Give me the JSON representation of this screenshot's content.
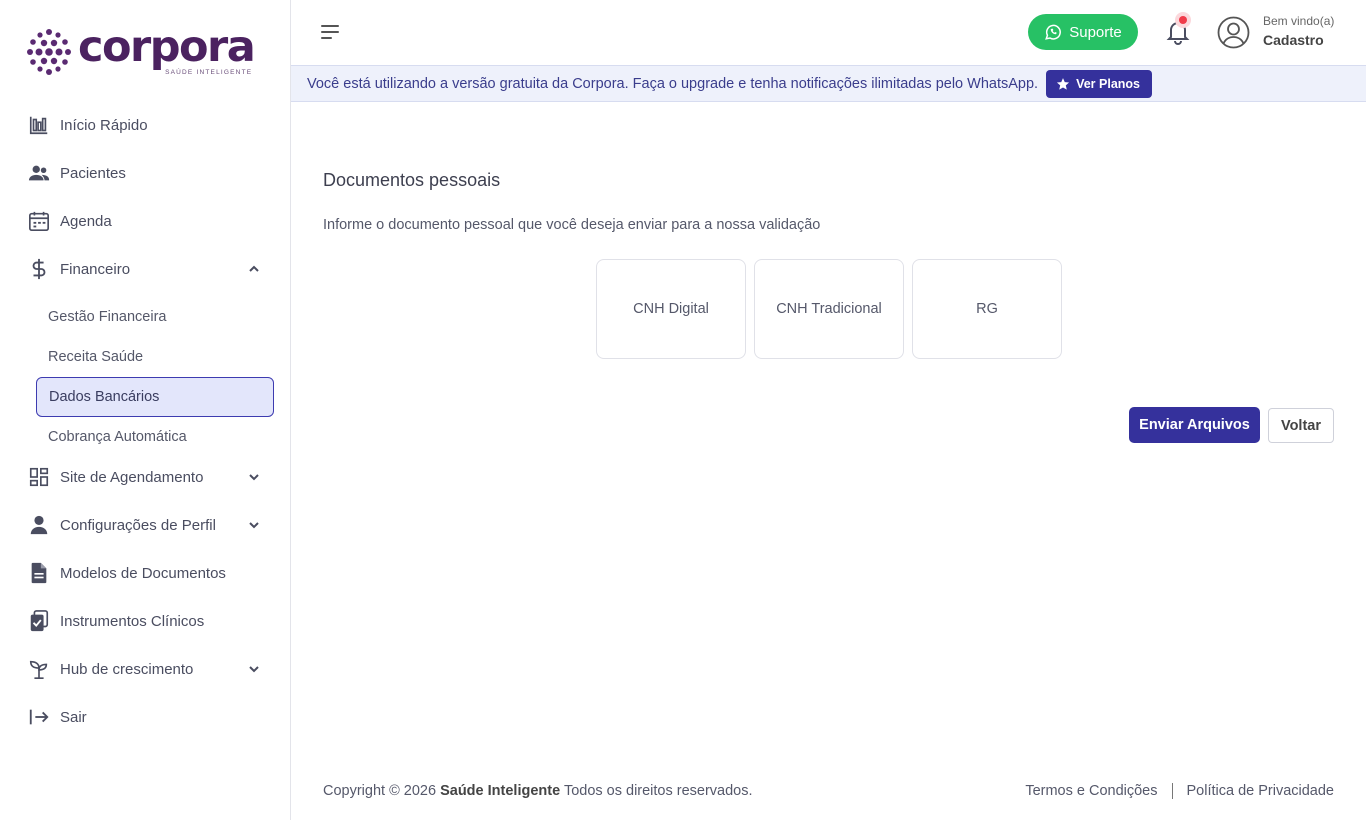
{
  "brand": {
    "name": "corpora",
    "tagline": "SAÚDE INTELIGENTE",
    "color": "#4b2260"
  },
  "sidebar": {
    "items": [
      {
        "label": "Início Rápido",
        "icon": "bar-chart-icon"
      },
      {
        "label": "Pacientes",
        "icon": "users-icon"
      },
      {
        "label": "Agenda",
        "icon": "calendar-icon"
      },
      {
        "label": "Financeiro",
        "icon": "dollar-icon",
        "expanded": true
      },
      {
        "label": "Site de Agendamento",
        "icon": "grid-icon",
        "expanded": false
      },
      {
        "label": "Configurações de Perfil",
        "icon": "user-icon",
        "expanded": false
      },
      {
        "label": "Modelos de Documentos",
        "icon": "document-icon"
      },
      {
        "label": "Instrumentos Clínicos",
        "icon": "clipboard-check-icon"
      },
      {
        "label": "Hub de crescimento",
        "icon": "sprout-icon",
        "expanded": false
      },
      {
        "label": "Sair",
        "icon": "logout-icon"
      }
    ],
    "financeiro_sub": [
      {
        "label": "Gestão Financeira"
      },
      {
        "label": "Receita Saúde"
      },
      {
        "label": "Dados Bancários",
        "active": true
      },
      {
        "label": "Cobrança Automática"
      }
    ]
  },
  "header": {
    "support_label": "Suporte",
    "welcome": "Bem vindo(a)",
    "user_name": "Cadastro"
  },
  "banner": {
    "text": "Você está utilizando a versão gratuita da Corpora. Faça o upgrade e tenha notificações ilimitadas pelo WhatsApp.",
    "button_label": "Ver Planos"
  },
  "main": {
    "title": "Documentos pessoais",
    "description": "Informe o documento pessoal que você deseja enviar para a nossa validação",
    "documents": [
      "CNH Digital",
      "CNH Tradicional",
      "RG"
    ],
    "send_label": "Enviar Arquivos",
    "back_label": "Voltar"
  },
  "footer": {
    "copyright_prefix": "Copyright © 2026",
    "company": "Saúde Inteligente",
    "copyright_suffix": "Todos os direitos reservados.",
    "terms": "Termos e Condições",
    "privacy": "Política de Privacidade"
  },
  "colors": {
    "primary": "#35319c",
    "support_green": "#27c165",
    "active_bg": "#e3e6fb",
    "banner_bg": "#eef1fb",
    "notification_red": "#f03b4a"
  }
}
